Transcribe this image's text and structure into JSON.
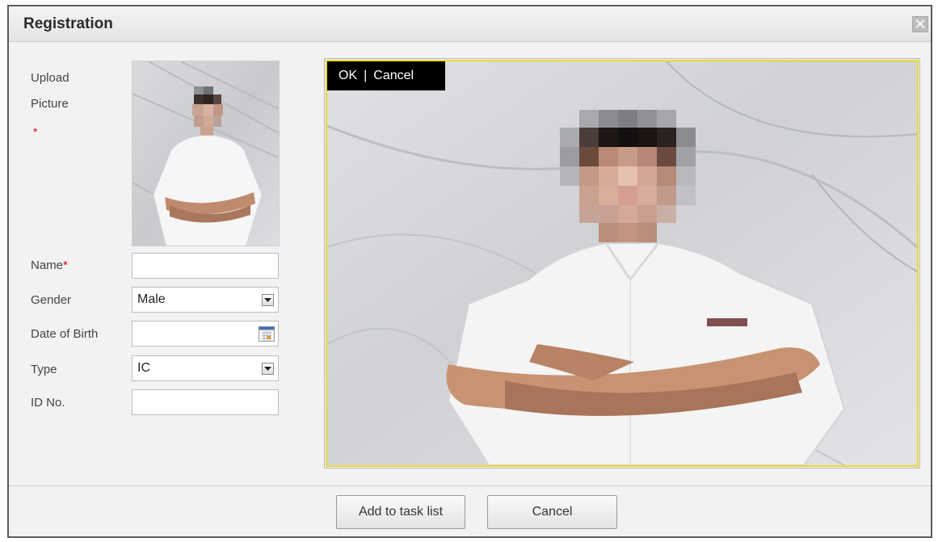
{
  "dialog": {
    "title": "Registration",
    "close_symbol": "✕"
  },
  "form": {
    "upload_label_line1": "Upload",
    "upload_label_line2": "Picture",
    "required_mark": "*",
    "name_label": "Name",
    "name_value": "",
    "gender_label": "Gender",
    "gender_value": "Male",
    "dob_label": "Date of Birth",
    "dob_value": "",
    "type_label": "Type",
    "type_value": "IC",
    "id_label": "ID No.",
    "id_value": ""
  },
  "preview": {
    "ok_label": "OK",
    "separator": "|",
    "cancel_label": "Cancel"
  },
  "footer": {
    "add_label": "Add to task list",
    "cancel_label": "Cancel"
  },
  "icons": {
    "close": "close-icon",
    "dropdown": "chevron-down-icon",
    "calendar": "calendar-icon"
  },
  "colors": {
    "crop_border": "#e6dc2e",
    "required": "#d40000"
  }
}
